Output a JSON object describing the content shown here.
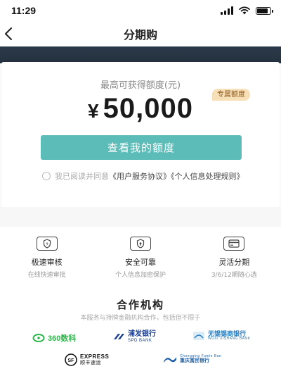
{
  "status_bar": {
    "time": "11:29"
  },
  "nav": {
    "title": "分期购"
  },
  "quota": {
    "label": "最高可获得额度(元)",
    "currency": "¥",
    "amount": "50,000",
    "badge": "专属额度",
    "button_label": "查看我的额度",
    "agree_text": "我已阅读并同意",
    "agree_link_1": "《用户服务协议》",
    "agree_link_2": "《个人信息处理规则》"
  },
  "features": [
    {
      "title": "极速审核",
      "desc": "在线快速审批",
      "icon": "lightning-shield-icon"
    },
    {
      "title": "安全可靠",
      "desc": "个人信息加密保护",
      "icon": "lock-shield-icon"
    },
    {
      "title": "灵活分期",
      "desc": "3/6/12期随心选",
      "icon": "card-icon"
    }
  ],
  "partners": {
    "title": "合作机构",
    "subtitle": "本服务与持牌金融机构合作，包括但不限于",
    "logos": [
      {
        "name": "360数科",
        "color": "#2db84b"
      },
      {
        "name": "浦发银行",
        "sub": "SPD BANK",
        "color": "#1d3f8f"
      },
      {
        "name": "无锡锡商银行",
        "sub": "WUXI XISHANG BANK",
        "color": "#2a7fc1"
      },
      {
        "name": "EXPRESS",
        "sub": "顺丰速运",
        "color": "#111111"
      },
      {
        "name": "Chongqing Fumin Ban",
        "sub": "重庆富民银行",
        "color": "#1e5fa8"
      }
    ]
  },
  "colors": {
    "primary": "#5bbcb8",
    "badge_bg": "#f7dfb7",
    "hero_bg": "#2b3a4a"
  }
}
